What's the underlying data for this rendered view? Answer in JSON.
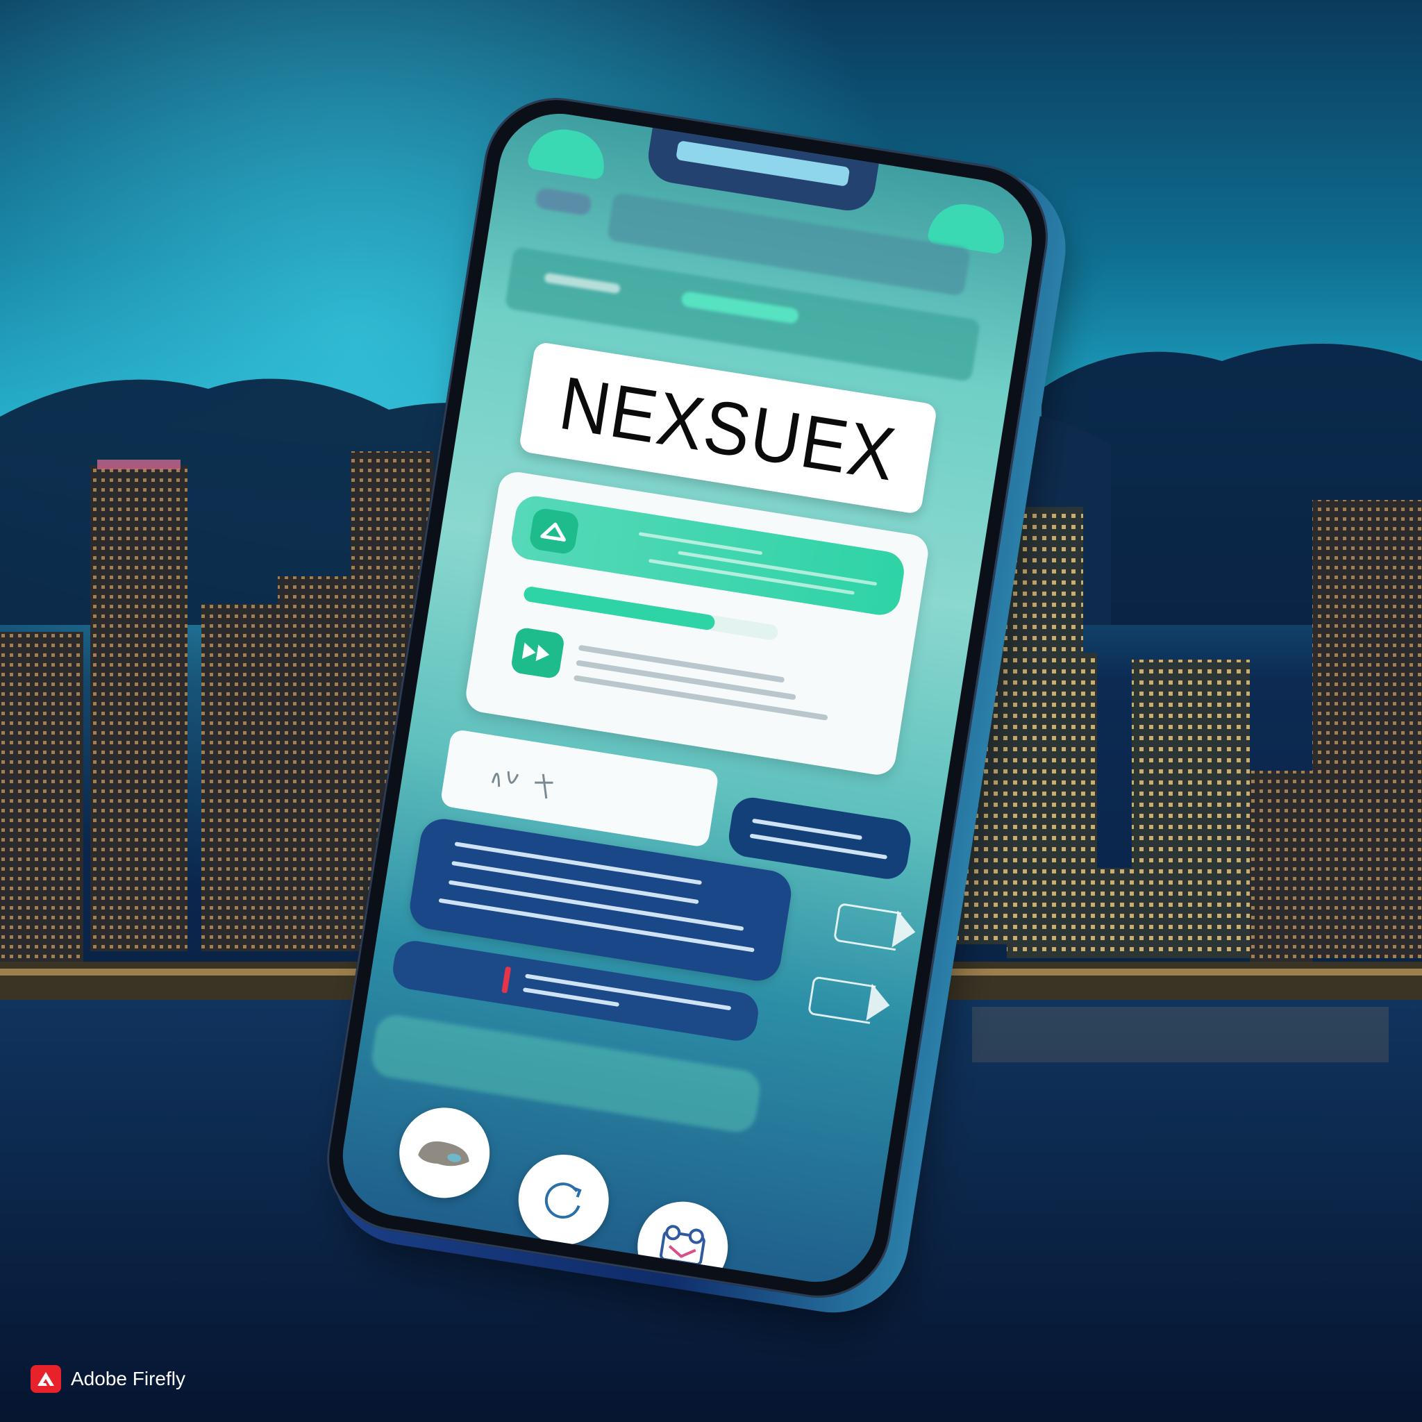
{
  "app": {
    "title": "NEXSUEX"
  },
  "main_card": {
    "progress": 0.75
  },
  "bottom_buttons": [
    {
      "icon": "stone-icon"
    },
    {
      "icon": "refresh-ring-icon"
    },
    {
      "icon": "chat-faces-icon"
    }
  ],
  "watermark": {
    "text": "Adobe Firefly",
    "logo_icon": "adobe-logo-icon"
  },
  "colors": {
    "accent_teal": "#2ed3a6",
    "navy": "#1a4787",
    "sky_top": "#08324f",
    "sky_glow": "#1aa3c6",
    "watermark_red": "#e8222b"
  }
}
